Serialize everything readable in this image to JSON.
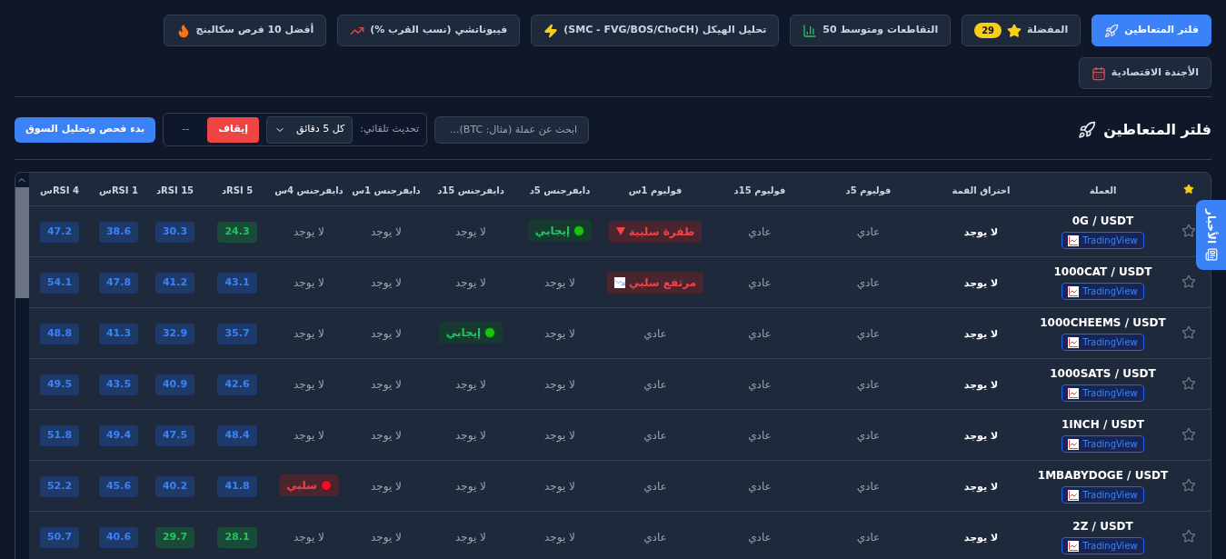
{
  "nav": [
    {
      "label": "فلتر المتعاطين",
      "selected": true
    },
    {
      "label": "المفضلة",
      "selected": false,
      "badge": "29"
    },
    {
      "label": "التقاطعات ومتوسط 50",
      "selected": false
    },
    {
      "label": "تحليل الهيكل (SMC - FVG/BOS/ChoCH)",
      "selected": false
    },
    {
      "label": "فيبوناتشي (نسب القرب %)",
      "selected": false
    },
    {
      "label": "أفضل 10 فرص سكالبنج",
      "selected": false
    },
    {
      "label": "الأجندة الاقتصادية",
      "selected": false
    }
  ],
  "page_title": "فلتر المتعاطين",
  "search": {
    "placeholder": "ابحث عن عملة (مثال: BTC)..."
  },
  "auto_refresh": {
    "label": "تحديث تلقائي:",
    "interval": "كل 5 دقائق",
    "stop_button": "إيقاف",
    "status": "--"
  },
  "scan_button": "بدء فحص وتحليل السوق",
  "news_tab": {
    "label": "الأخبار"
  },
  "table": {
    "columns": [
      "العملة",
      "اختراق القمة",
      "فوليوم 5د",
      "فوليوم 15د",
      "فوليوم 1س",
      "دايفرجنس 5د",
      "دايفرجنس 15د",
      "دايفرجنس 1س",
      "دايفرجنس 4س",
      "RSI 5د",
      "RSI 15د",
      "RSI 1س",
      "RSI 4س"
    ],
    "rows": [
      {
        "pair": "0G / USDT",
        "link": "TradingView",
        "breakout": "لا يوجد",
        "volume": [
          {
            "kind": "normal",
            "text": "عادي"
          },
          {
            "kind": "normal",
            "text": "عادي"
          },
          {
            "kind": "spike_down",
            "text": "طفرة سلبية"
          }
        ],
        "divergence": [
          {
            "kind": "positive",
            "text": "إيجابي"
          },
          {
            "kind": "none",
            "text": "لا يوجد"
          },
          {
            "kind": "none",
            "text": "لا يوجد"
          },
          {
            "kind": "none",
            "text": "لا يوجد"
          }
        ],
        "rsi": [
          {
            "kind": "oversold",
            "text": "24.3"
          },
          {
            "kind": "normal",
            "text": "30.3"
          },
          {
            "kind": "normal",
            "text": "38.6"
          },
          {
            "kind": "normal",
            "text": "47.2"
          }
        ]
      },
      {
        "pair": "1000CAT / USDT",
        "link": "TradingView",
        "breakout": "لا يوجد",
        "volume": [
          {
            "kind": "normal",
            "text": "عادي"
          },
          {
            "kind": "normal",
            "text": "عادي"
          },
          {
            "kind": "high_down",
            "text": "مرتفع سلبي"
          }
        ],
        "divergence": [
          {
            "kind": "none",
            "text": "لا يوجد"
          },
          {
            "kind": "none",
            "text": "لا يوجد"
          },
          {
            "kind": "none",
            "text": "لا يوجد"
          },
          {
            "kind": "none",
            "text": "لا يوجد"
          }
        ],
        "rsi": [
          {
            "kind": "normal",
            "text": "43.1"
          },
          {
            "kind": "normal",
            "text": "41.2"
          },
          {
            "kind": "normal",
            "text": "47.8"
          },
          {
            "kind": "normal",
            "text": "54.1"
          }
        ]
      },
      {
        "pair": "1000CHEEMS / USDT",
        "link": "TradingView",
        "breakout": "لا يوجد",
        "volume": [
          {
            "kind": "normal",
            "text": "عادي"
          },
          {
            "kind": "normal",
            "text": "عادي"
          },
          {
            "kind": "normal",
            "text": "عادي"
          }
        ],
        "divergence": [
          {
            "kind": "none",
            "text": "لا يوجد"
          },
          {
            "kind": "positive",
            "text": "إيجابي"
          },
          {
            "kind": "none",
            "text": "لا يوجد"
          },
          {
            "kind": "none",
            "text": "لا يوجد"
          }
        ],
        "rsi": [
          {
            "kind": "normal",
            "text": "35.7"
          },
          {
            "kind": "normal",
            "text": "32.9"
          },
          {
            "kind": "normal",
            "text": "41.3"
          },
          {
            "kind": "normal",
            "text": "48.8"
          }
        ]
      },
      {
        "pair": "1000SATS / USDT",
        "link": "TradingView",
        "breakout": "لا يوجد",
        "volume": [
          {
            "kind": "normal",
            "text": "عادي"
          },
          {
            "kind": "normal",
            "text": "عادي"
          },
          {
            "kind": "normal",
            "text": "عادي"
          }
        ],
        "divergence": [
          {
            "kind": "none",
            "text": "لا يوجد"
          },
          {
            "kind": "none",
            "text": "لا يوجد"
          },
          {
            "kind": "none",
            "text": "لا يوجد"
          },
          {
            "kind": "none",
            "text": "لا يوجد"
          }
        ],
        "rsi": [
          {
            "kind": "normal",
            "text": "42.6"
          },
          {
            "kind": "normal",
            "text": "40.9"
          },
          {
            "kind": "normal",
            "text": "43.5"
          },
          {
            "kind": "normal",
            "text": "49.5"
          }
        ]
      },
      {
        "pair": "1INCH / USDT",
        "link": "TradingView",
        "breakout": "لا يوجد",
        "volume": [
          {
            "kind": "normal",
            "text": "عادي"
          },
          {
            "kind": "normal",
            "text": "عادي"
          },
          {
            "kind": "normal",
            "text": "عادي"
          }
        ],
        "divergence": [
          {
            "kind": "none",
            "text": "لا يوجد"
          },
          {
            "kind": "none",
            "text": "لا يوجد"
          },
          {
            "kind": "none",
            "text": "لا يوجد"
          },
          {
            "kind": "none",
            "text": "لا يوجد"
          }
        ],
        "rsi": [
          {
            "kind": "normal",
            "text": "48.4"
          },
          {
            "kind": "normal",
            "text": "47.5"
          },
          {
            "kind": "normal",
            "text": "49.4"
          },
          {
            "kind": "normal",
            "text": "51.8"
          }
        ]
      },
      {
        "pair": "1MBABYDOGE / USDT",
        "link": "TradingView",
        "breakout": "لا يوجد",
        "volume": [
          {
            "kind": "normal",
            "text": "عادي"
          },
          {
            "kind": "normal",
            "text": "عادي"
          },
          {
            "kind": "normal",
            "text": "عادي"
          }
        ],
        "divergence": [
          {
            "kind": "none",
            "text": "لا يوجد"
          },
          {
            "kind": "none",
            "text": "لا يوجد"
          },
          {
            "kind": "none",
            "text": "لا يوجد"
          },
          {
            "kind": "negative",
            "text": "سلبي"
          }
        ],
        "rsi": [
          {
            "kind": "normal",
            "text": "41.8"
          },
          {
            "kind": "normal",
            "text": "40.2"
          },
          {
            "kind": "normal",
            "text": "45.6"
          },
          {
            "kind": "normal",
            "text": "52.2"
          }
        ]
      },
      {
        "pair": "2Z / USDT",
        "link": "TradingView",
        "breakout": "لا يوجد",
        "volume": [
          {
            "kind": "normal",
            "text": "عادي"
          },
          {
            "kind": "normal",
            "text": "عادي"
          },
          {
            "kind": "normal",
            "text": "عادي"
          }
        ],
        "divergence": [
          {
            "kind": "none",
            "text": "لا يوجد"
          },
          {
            "kind": "none",
            "text": "لا يوجد"
          },
          {
            "kind": "none",
            "text": "لا يوجد"
          },
          {
            "kind": "none",
            "text": "لا يوجد"
          }
        ],
        "rsi": [
          {
            "kind": "oversold",
            "text": "28.1"
          },
          {
            "kind": "oversold",
            "text": "29.7"
          },
          {
            "kind": "normal",
            "text": "40.6"
          },
          {
            "kind": "normal",
            "text": "50.7"
          }
        ]
      }
    ]
  }
}
